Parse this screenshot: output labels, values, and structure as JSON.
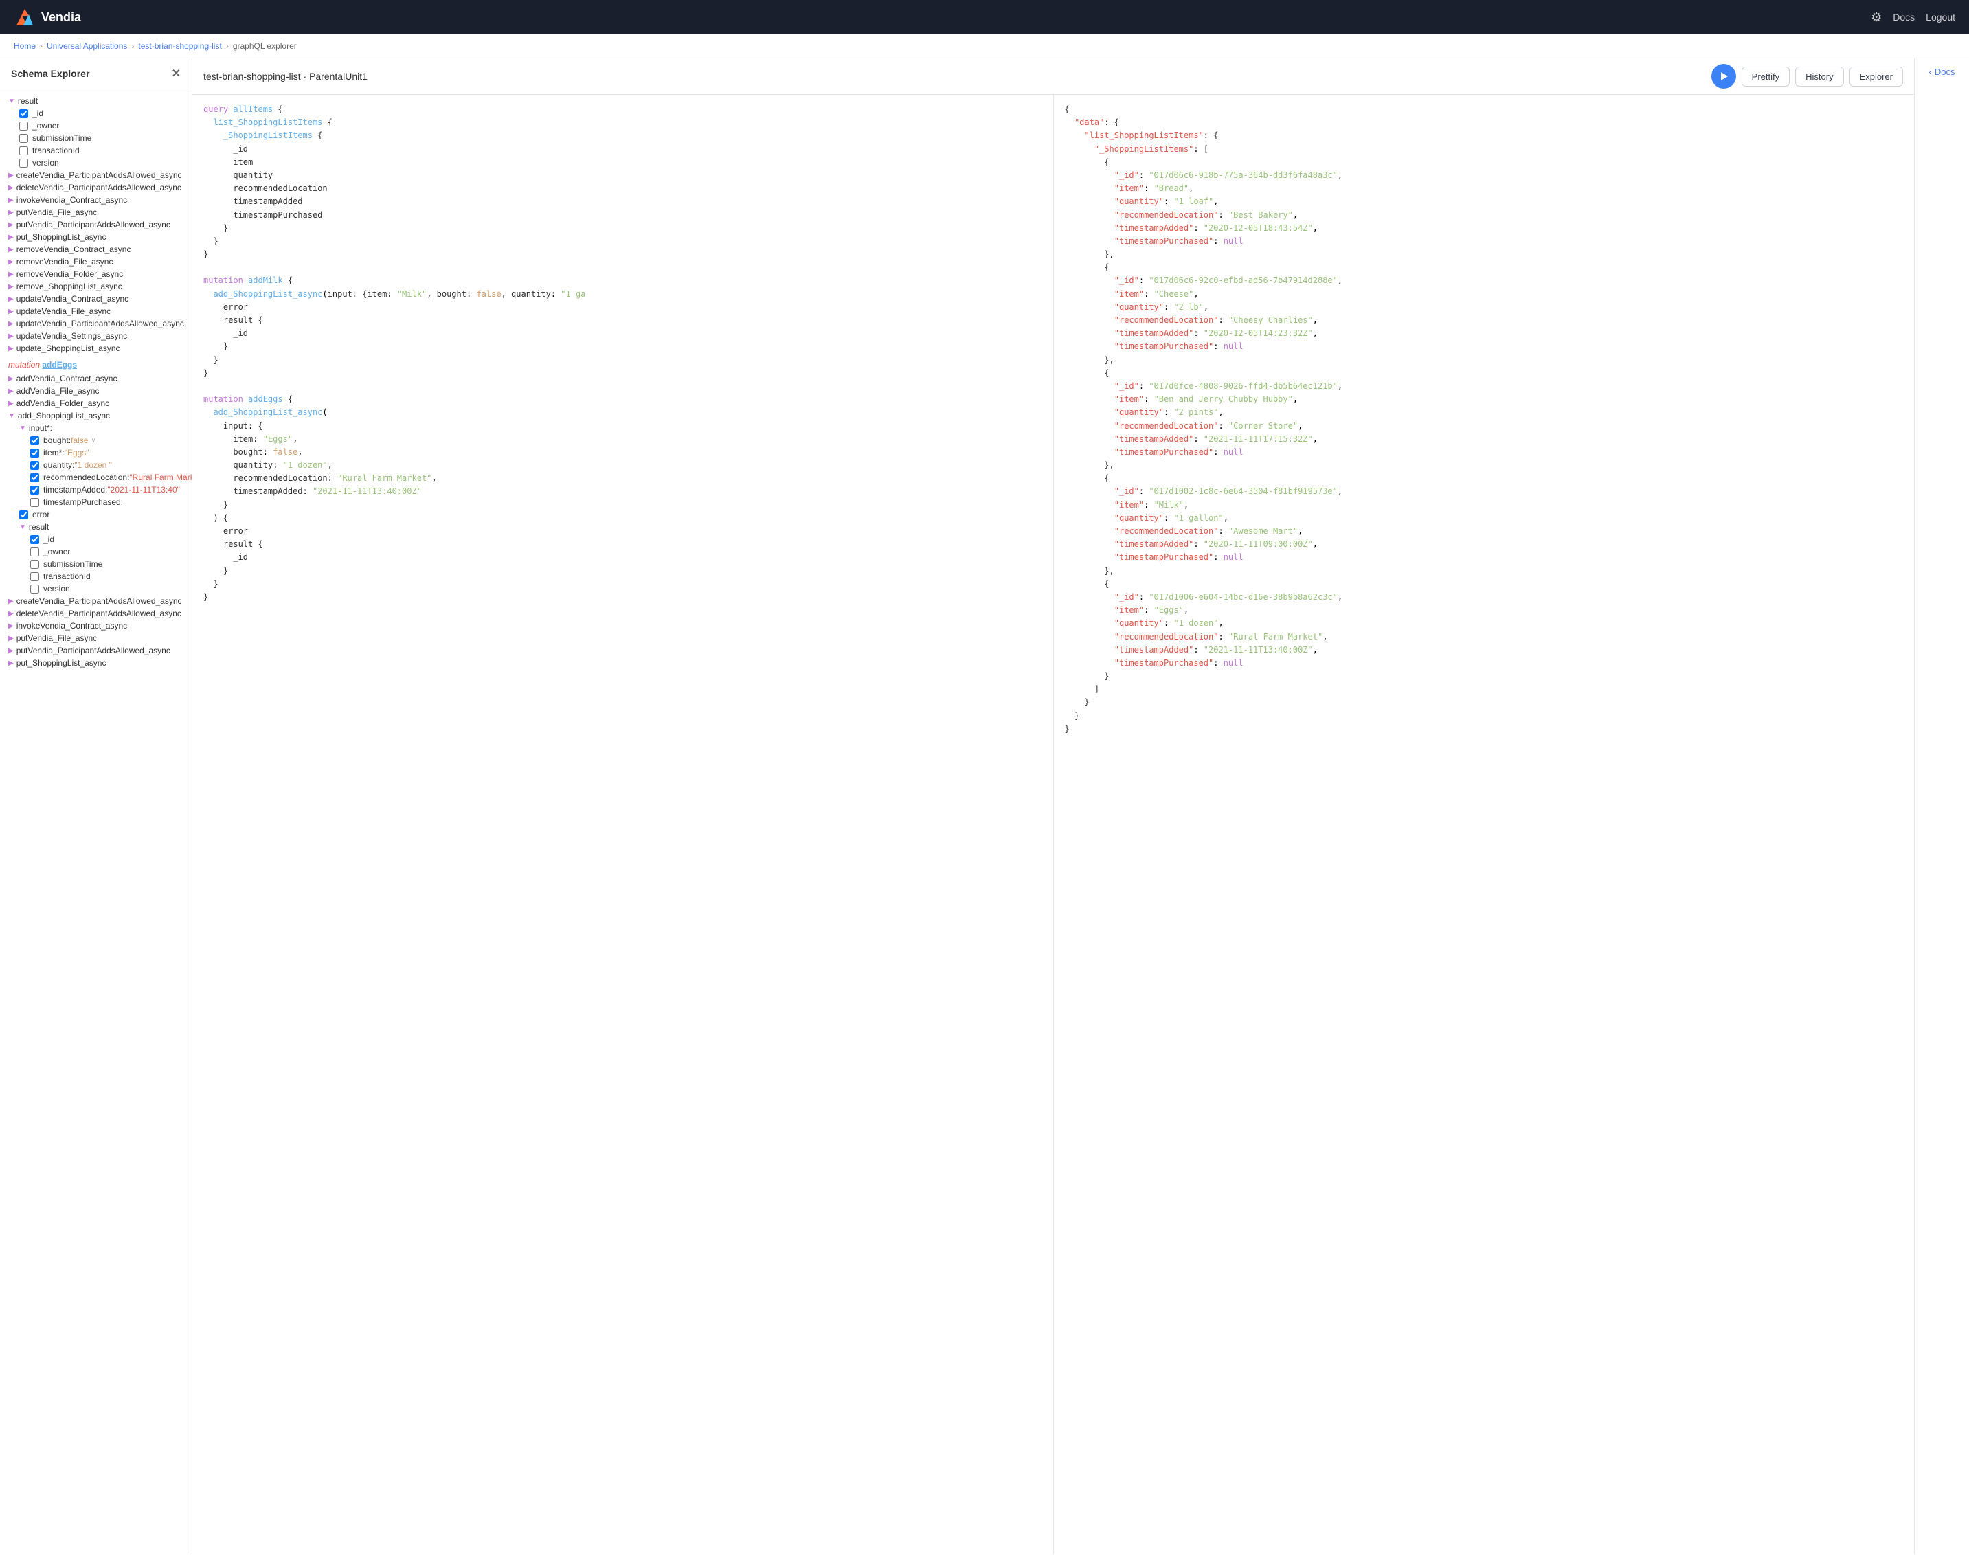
{
  "topNav": {
    "brand": "Vendia",
    "docsLink": "Docs",
    "logoutLink": "Logout"
  },
  "breadcrumb": {
    "items": [
      "Home",
      "Universal Applications",
      "test-brian-shopping-list",
      "graphQL explorer"
    ]
  },
  "sidebar": {
    "title": "Schema Explorer",
    "sections": [
      {
        "type": "tree",
        "items": [
          {
            "indent": 0,
            "toggle": "▼",
            "label": "result",
            "checked": null
          },
          {
            "indent": 1,
            "toggle": null,
            "label": "_id",
            "checked": true
          },
          {
            "indent": 1,
            "toggle": null,
            "label": "_owner",
            "checked": false
          },
          {
            "indent": 1,
            "toggle": null,
            "label": "submissionTime",
            "checked": false
          },
          {
            "indent": 1,
            "toggle": null,
            "label": "transactionId",
            "checked": false
          },
          {
            "indent": 1,
            "toggle": null,
            "label": "version",
            "checked": false
          },
          {
            "indent": 0,
            "toggle": "▶",
            "label": "createVendia_ParticipantAddsAllowed_async",
            "checked": null
          },
          {
            "indent": 0,
            "toggle": "▶",
            "label": "deleteVendia_ParticipantAddsAllowed_async",
            "checked": null
          },
          {
            "indent": 0,
            "toggle": "▶",
            "label": "invokeVendia_Contract_async",
            "checked": null
          },
          {
            "indent": 0,
            "toggle": "▶",
            "label": "putVendia_File_async",
            "checked": null
          },
          {
            "indent": 0,
            "toggle": "▶",
            "label": "putVendia_ParticipantAddsAllowed_async",
            "checked": null
          },
          {
            "indent": 0,
            "toggle": "▶",
            "label": "put_ShoppingList_async",
            "checked": null
          },
          {
            "indent": 0,
            "toggle": "▶",
            "label": "removeVendia_Contract_async",
            "checked": null
          },
          {
            "indent": 0,
            "toggle": "▶",
            "label": "removeVendia_File_async",
            "checked": null
          },
          {
            "indent": 0,
            "toggle": "▶",
            "label": "removeVendia_Folder_async",
            "checked": null
          },
          {
            "indent": 0,
            "toggle": "▶",
            "label": "remove_ShoppingList_async",
            "checked": null
          },
          {
            "indent": 0,
            "toggle": "▶",
            "label": "updateVendia_Contract_async",
            "checked": null
          },
          {
            "indent": 0,
            "toggle": "▶",
            "label": "updateVendia_File_async",
            "checked": null
          },
          {
            "indent": 0,
            "toggle": "▶",
            "label": "updateVendia_ParticipantAddsAllowed_async",
            "checked": null
          },
          {
            "indent": 0,
            "toggle": "▶",
            "label": "updateVendia_Settings_async",
            "checked": null
          },
          {
            "indent": 0,
            "toggle": "▶",
            "label": "update_ShoppingList_async",
            "checked": null
          }
        ]
      },
      {
        "type": "mutation",
        "label": "mutation addEggs",
        "items": [
          {
            "indent": 0,
            "toggle": "▶",
            "label": "addVendia_Contract_async"
          },
          {
            "indent": 0,
            "toggle": "▶",
            "label": "addVendia_File_async"
          },
          {
            "indent": 0,
            "toggle": "▶",
            "label": "addVendia_Folder_async"
          },
          {
            "indent": 0,
            "toggle": "▼",
            "label": "add_ShoppingList_async"
          },
          {
            "indent": 1,
            "toggle": "▼",
            "label": "input*:"
          },
          {
            "indent": 2,
            "toggle": null,
            "label": "bought: false",
            "checked": true,
            "hasChevron": true
          },
          {
            "indent": 2,
            "toggle": null,
            "label": "item*: \"Eggs\"",
            "checked": true,
            "valueColor": "orange"
          },
          {
            "indent": 2,
            "toggle": null,
            "label": "quantity: \"1 dozen \"",
            "checked": true,
            "valueColor": "orange"
          },
          {
            "indent": 2,
            "toggle": null,
            "label": "recommendedLocation: \"Rural Farm Market\"",
            "checked": true,
            "valueColor": "red"
          },
          {
            "indent": 2,
            "toggle": null,
            "label": "timestampAdded: \"2021-11-11T13:40\"",
            "checked": true,
            "valueColor": "red"
          },
          {
            "indent": 2,
            "toggle": null,
            "label": "timestampPurchased:",
            "checked": false
          },
          {
            "indent": 1,
            "toggle": null,
            "label": "error",
            "checked": true
          },
          {
            "indent": 1,
            "toggle": "▼",
            "label": "result"
          },
          {
            "indent": 2,
            "toggle": null,
            "label": "_id",
            "checked": true
          },
          {
            "indent": 2,
            "toggle": null,
            "label": "_owner",
            "checked": false
          },
          {
            "indent": 2,
            "toggle": null,
            "label": "submissionTime",
            "checked": false
          },
          {
            "indent": 2,
            "toggle": null,
            "label": "transactionId",
            "checked": false
          },
          {
            "indent": 2,
            "toggle": null,
            "label": "version",
            "checked": false
          },
          {
            "indent": 0,
            "toggle": "▶",
            "label": "createVendia_ParticipantAddsAllowed_async"
          },
          {
            "indent": 0,
            "toggle": "▶",
            "label": "deleteVendia_ParticipantAddsAllowed_async"
          },
          {
            "indent": 0,
            "toggle": "▶",
            "label": "invokeVendia_Contract_async"
          },
          {
            "indent": 0,
            "toggle": "▶",
            "label": "putVendia_File_async"
          },
          {
            "indent": 0,
            "toggle": "▶",
            "label": "putVendia_ParticipantAddsAllowed_async"
          },
          {
            "indent": 0,
            "toggle": "▶",
            "label": "put_ShoppingList_async"
          }
        ]
      }
    ]
  },
  "editor": {
    "title": "test-brian-shopping-list · ParentalUnit1",
    "buttons": {
      "prettify": "Prettify",
      "history": "History",
      "explorer": "Explorer"
    }
  },
  "queryCode": "query allItems {\n  list_ShoppingListItems {\n    _ShoppingListItems {\n      _id\n      item\n      quantity\n      recommendedLocation\n      timestampAdded\n      timestampPurchased\n    }\n  }\n}\n\nmutation addMilk {\n  add_ShoppingList_async(input: {item: \"Milk\", bought: false, quantity: \"1 ga\n    error\n    result {\n      _id\n    }\n  }\n}\n\nmutation addEggs {\n  add_ShoppingList_async(\n    input: {\n      item: \"Eggs\",\n      bought: false,\n      quantity: \"1 dozen\",\n      recommendedLocation: \"Rural Farm Market\",\n      timestampAdded: \"2021-11-11T13:40:00Z\"\n    }\n  ) {\n    error\n    result {\n      _id\n    }\n  }\n}",
  "resultData": {
    "items": [
      {
        "_id": "017d06c6-918b-775a-364b-dd3f6fa48a3c",
        "item": "Bread",
        "quantity": "1 loaf",
        "recommendedLocation": "Best Bakery",
        "timestampAdded": "2020-12-05T18:43:54Z",
        "timestampPurchased": "null"
      },
      {
        "_id": "017d06c6-92c0-efbd-ad56-7b47914d288e",
        "item": "Cheese",
        "quantity": "2 lb",
        "recommendedLocation": "Cheesy Charlies",
        "timestampAdded": "2020-12-05T14:23:32Z",
        "timestampPurchased": "null"
      },
      {
        "_id": "017d0fce-4808-9026-ffd4-db5b64ec121b",
        "item": "Ben and Jerry Chubby Hubby",
        "quantity": "2 pints",
        "recommendedLocation": "Corner Store",
        "timestampAdded": "2021-11-11T17:15:32Z",
        "timestampPurchased": "null"
      },
      {
        "_id": "017d1002-1c8c-6e64-3504-f81bf919573e",
        "item": "Milk",
        "quantity": "1 gallon",
        "recommendedLocation": "Awesome Mart",
        "timestampAdded": "2020-11-11T09:00:00Z",
        "timestampPurchased": "null"
      },
      {
        "_id": "017d1006-e604-14bc-d16e-38b9b8a62c3c",
        "item": "Eggs",
        "quantity": "1 dozen",
        "recommendedLocation": "Rural Farm Market",
        "timestampAdded": "2021-11-11T13:40:00Z",
        "timestampPurchased": "null"
      }
    ]
  },
  "docsPanel": {
    "label": "Docs",
    "chevron": "‹"
  }
}
